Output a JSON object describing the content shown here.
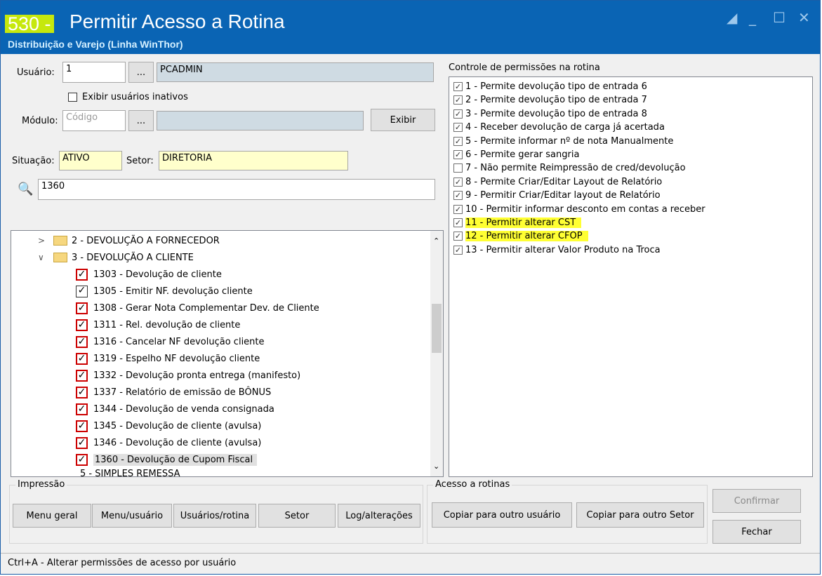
{
  "window": {
    "number": "530 -",
    "title": "Permitir Acesso a Rotina",
    "subtitle": "Distribuição e Varejo (Linha WinThor)",
    "controls": [
      "restore-icon",
      "minimize-icon",
      "maximize-icon",
      "close-icon"
    ]
  },
  "form": {
    "usuario_label": "Usuário:",
    "usuario_code": "1",
    "browse_label": "...",
    "usuario_name": "PCADMIN",
    "inativos_label": "Exibir usuários inativos",
    "modulo_label": "Módulo:",
    "modulo_placeholder": "Código",
    "modulo_name": "",
    "exibir_label": "Exibir",
    "situacao_label": "Situação:",
    "situacao_value": "ATIVO",
    "setor_label": "Setor:",
    "setor_value": "DIRETORIA",
    "search_value": "1360"
  },
  "tree": {
    "groups": [
      {
        "label": "2 - DEVOLUÇÃO A FORNECEDOR",
        "expanded": false
      },
      {
        "label": "3 - DEVOLUÇÃO A CLIENTE",
        "expanded": true
      }
    ],
    "items": [
      {
        "label": "1303 - Devolução de cliente",
        "checked": true,
        "style": "red"
      },
      {
        "label": "1305 - Emitir NF. devolução cliente",
        "checked": true,
        "style": "black"
      },
      {
        "label": "1308 - Gerar Nota Complementar Dev. de Cliente",
        "checked": true,
        "style": "red"
      },
      {
        "label": "1311 - Rel. devolução de cliente",
        "checked": true,
        "style": "red"
      },
      {
        "label": "1316 - Cancelar NF devolução cliente",
        "checked": true,
        "style": "red"
      },
      {
        "label": "1319 - Espelho NF devolução cliente",
        "checked": true,
        "style": "red"
      },
      {
        "label": "1332 - Devolução pronta entrega (manifesto)",
        "checked": true,
        "style": "red"
      },
      {
        "label": "1337 - Relatório de emissão de BÔNUS",
        "checked": true,
        "style": "red"
      },
      {
        "label": "1344 - Devolução de venda consignada",
        "checked": true,
        "style": "red"
      },
      {
        "label": "1345 - Devolução de cliente (avulsa)",
        "checked": true,
        "style": "red"
      },
      {
        "label": "1346 - Devolução de cliente (avulsa)",
        "checked": true,
        "style": "red"
      },
      {
        "label": "1360 - Devolução de Cupom Fiscal",
        "checked": true,
        "style": "red",
        "selected": true
      }
    ],
    "partial_next": "5 - SIMPLES REMESSA"
  },
  "permissions": {
    "title": "Controle de permissões na rotina",
    "items": [
      {
        "label": "1 - Permite devolução tipo de entrada 6",
        "checked": true
      },
      {
        "label": "2 - Permite devolução tipo de entrada 7",
        "checked": true
      },
      {
        "label": "3 - Permite devolução tipo de entrada 8",
        "checked": true
      },
      {
        "label": "4 - Receber devolução de carga já acertada",
        "checked": true
      },
      {
        "label": "5 - Permite informar nº de nota Manualmente",
        "checked": true
      },
      {
        "label": "6 - Permite gerar sangria",
        "checked": true
      },
      {
        "label": "7 - Não permite Reimpressão de cred/devolução",
        "checked": false
      },
      {
        "label": "8 - Permite Criar/Editar Layout de Relatório",
        "checked": true
      },
      {
        "label": "9 - Permitir Criar/Editar layout de Relatório",
        "checked": true
      },
      {
        "label": "10 - Permitir informar desconto em contas a receber",
        "checked": true
      },
      {
        "label": "11 - Permitir alterar CST",
        "checked": true,
        "highlight": true
      },
      {
        "label": "12 - Permitir alterar CFOP",
        "checked": true,
        "highlight": true
      },
      {
        "label": "13 - Permitir alterar Valor Produto na Troca",
        "checked": true
      }
    ]
  },
  "impressao": {
    "title": "Impressão",
    "buttons": [
      "Menu geral",
      "Menu/usuário",
      "Usuários/rotina",
      "Setor",
      "Log/alterações"
    ]
  },
  "acesso": {
    "title": "Acesso a rotinas",
    "buttons": [
      "Copiar para outro usuário",
      "Copiar para outro Setor"
    ]
  },
  "actions": {
    "confirmar": "Confirmar",
    "fechar": "Fechar"
  },
  "status": "Ctrl+A - Alterar permissões de acesso por usuário",
  "colors": {
    "title_bar": "#0a64b4",
    "highlight": "#ffff33",
    "number_bg": "#c6e80c",
    "yellow_field": "#ffffcc"
  }
}
